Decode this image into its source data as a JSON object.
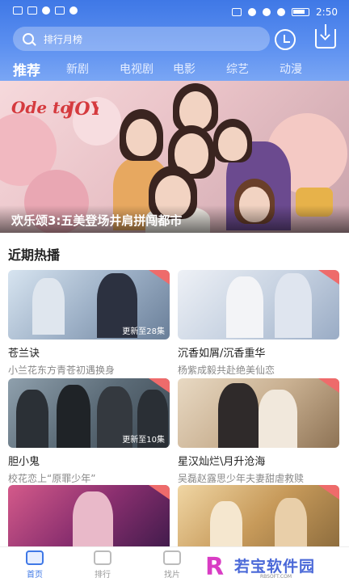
{
  "status_bar": {
    "time": "2:50"
  },
  "search": {
    "placeholder": "排行月榜"
  },
  "tabs": [
    {
      "label": "推荐",
      "active": true
    },
    {
      "label": "新剧",
      "active": false
    },
    {
      "label": "电视剧",
      "active": false
    },
    {
      "label": "电影",
      "active": false
    },
    {
      "label": "综艺",
      "active": false
    },
    {
      "label": "动漫",
      "active": false
    }
  ],
  "banner": {
    "title": "欢乐颂3:五美登场井肩拼闯都市",
    "logo": "Ode to Joy"
  },
  "section": {
    "title": "近期热播"
  },
  "cards": [
    {
      "name": "苍兰诀",
      "desc": "小兰花东方青苍初遇换身",
      "episode": "更新至28集"
    },
    {
      "name": "沉香如屑/沉香重华",
      "desc": "杨紫成毅共赴绝美仙恋",
      "episode": ""
    },
    {
      "name": "胆小鬼",
      "desc": "校花恋上“原罪少年”",
      "episode": "更新至10集"
    },
    {
      "name": "星汉灿烂\\月升沧海",
      "desc": "吴磊赵露思少年夫妻甜虐救赎",
      "episode": ""
    },
    {
      "name": "",
      "desc": "",
      "episode": ""
    },
    {
      "name": "",
      "desc": "",
      "episode": ""
    }
  ],
  "bottom_nav": [
    {
      "label": "首页",
      "active": true
    },
    {
      "label": "排行",
      "active": false
    },
    {
      "label": "找片",
      "active": false
    }
  ],
  "watermark": {
    "mark": "R",
    "text": "若宝软件园",
    "url": "RBSOFT.COM"
  },
  "colors": {
    "accent": "#3f78e6",
    "corner_badge": "#ee6b6b"
  }
}
